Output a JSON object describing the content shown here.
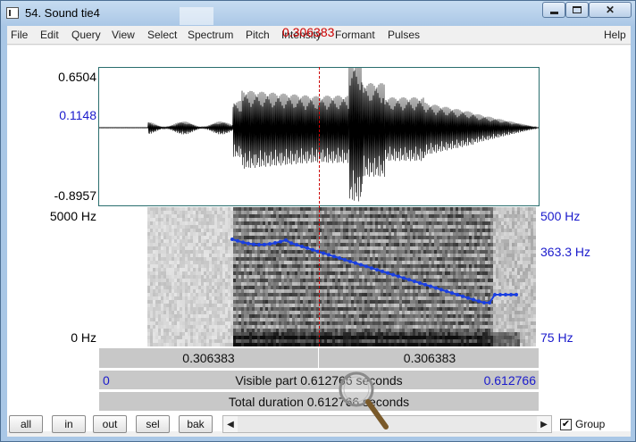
{
  "window": {
    "title": "54. Sound tie4",
    "minimize_label": "",
    "maximize_label": "",
    "close_label": "✕"
  },
  "menu": [
    "File",
    "Edit",
    "Query",
    "View",
    "Select",
    "Spectrum",
    "Pitch",
    "Intensity",
    "Formant",
    "Pulses",
    "Help"
  ],
  "cursor_time": "0.306383",
  "waveform": {
    "y_max": "0.6504",
    "y_cursor": "0.1148",
    "y_min": "-0.8957"
  },
  "spectrogram": {
    "freq_max": "5000 Hz",
    "freq_min": "0 Hz",
    "pitch_max": "500 Hz",
    "pitch_cursor": "363.3 Hz",
    "pitch_min": "75 Hz"
  },
  "bars": {
    "left_segment": "0.306383",
    "right_segment": "0.306383",
    "visible_start": "0",
    "visible_part": "Visible part 0.612766 seconds",
    "visible_end": "0.612766",
    "total_duration": "Total duration 0.612766 seconds"
  },
  "toolbar": {
    "all": "all",
    "in": "in",
    "out": "out",
    "sel": "sel",
    "bak": "bak",
    "group_checked": "✔",
    "group_label": "Group"
  },
  "colors": {
    "cursor": "#cc0000",
    "pitch_track": "#1a3fe0",
    "axis_blue": "#1a1acc"
  }
}
